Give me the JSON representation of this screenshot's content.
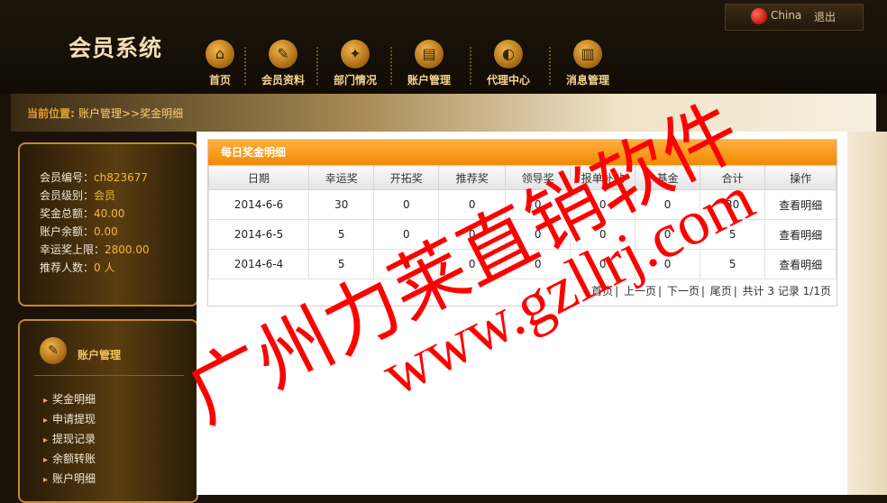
{
  "topbar": {
    "lang": "China",
    "logout": "退出"
  },
  "header": {
    "title": "会员系统"
  },
  "nav": [
    {
      "label": "首页",
      "icon": "home-icon",
      "glyph": "⌂"
    },
    {
      "label": "会员资料",
      "icon": "edit-icon",
      "glyph": "✎"
    },
    {
      "label": "部门情况",
      "icon": "network-icon",
      "glyph": "✦"
    },
    {
      "label": "账户管理",
      "icon": "document-icon",
      "glyph": "▤"
    },
    {
      "label": "代理中心",
      "icon": "mouse-icon",
      "glyph": "◐"
    },
    {
      "label": "消息管理",
      "icon": "chart-icon",
      "glyph": "▥"
    }
  ],
  "breadcrumb": {
    "prefix": "当前位置:",
    "path": "账户管理>>奖金明细"
  },
  "info": [
    {
      "k": "会员编号：",
      "v": "ch823677"
    },
    {
      "k": "会员级别：",
      "v": "会员"
    },
    {
      "k": "奖金总额：",
      "v": "40.00"
    },
    {
      "k": "账户余额：",
      "v": "0.00"
    },
    {
      "k": "幸运奖上限：",
      "v": "2800.00"
    },
    {
      "k": "推荐人数：",
      "v": "0 人"
    }
  ],
  "menu": {
    "title": "账户管理",
    "items": [
      "奖金明细",
      "申请提现",
      "提现记录",
      "余额转账",
      "账户明细"
    ]
  },
  "table": {
    "title": "每日奖金明细",
    "columns": [
      "日期",
      "幸运奖",
      "开拓奖",
      "推荐奖",
      "领导奖",
      "报单补贴",
      "基金",
      "合计",
      "操作"
    ],
    "rows": [
      [
        "2014-6-6",
        "30",
        "0",
        "0",
        "0",
        "0",
        "0",
        "30",
        "查看明细"
      ],
      [
        "2014-6-5",
        "5",
        "0",
        "0",
        "0",
        "0",
        "0",
        "5",
        "查看明细"
      ],
      [
        "2014-6-4",
        "5",
        "0",
        "0",
        "0",
        "0",
        "0",
        "5",
        "查看明细"
      ]
    ]
  },
  "pager": {
    "first": "首页",
    "prev": "上一页",
    "next": "下一页",
    "last": "尾页",
    "summary": "共计 3 记录 1/1页"
  },
  "watermark": {
    "line1": "广州力莱直销软件",
    "line2": "www.gzllrj.com",
    "color": "#ff0000"
  }
}
